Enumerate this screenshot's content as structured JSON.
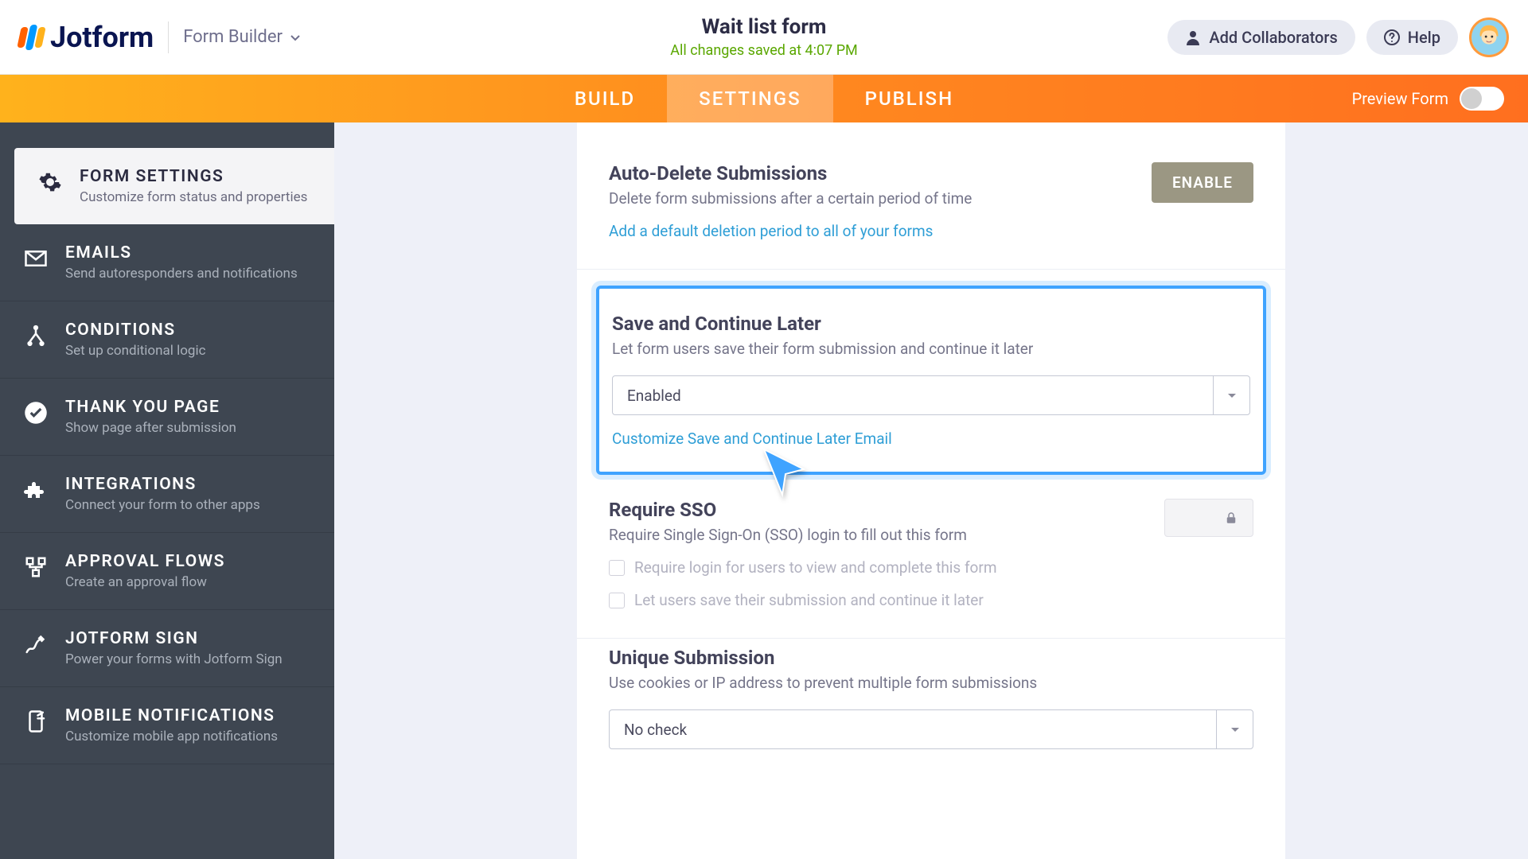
{
  "header": {
    "brand": "Jotform",
    "builder_label": "Form Builder",
    "form_title": "Wait list form",
    "save_status": "All changes saved at 4:07 PM",
    "collab_label": "Add Collaborators",
    "help_label": "Help"
  },
  "tabs": {
    "build": "BUILD",
    "settings": "SETTINGS",
    "publish": "PUBLISH",
    "preview_label": "Preview Form"
  },
  "sidebar": [
    {
      "title": "FORM SETTINGS",
      "desc": "Customize form status and properties",
      "icon": "gear-icon",
      "active": true
    },
    {
      "title": "EMAILS",
      "desc": "Send autoresponders and notifications",
      "icon": "mail-icon"
    },
    {
      "title": "CONDITIONS",
      "desc": "Set up conditional logic",
      "icon": "branch-icon"
    },
    {
      "title": "THANK YOU PAGE",
      "desc": "Show page after submission",
      "icon": "check-circle-icon"
    },
    {
      "title": "INTEGRATIONS",
      "desc": "Connect your form to other apps",
      "icon": "puzzle-icon"
    },
    {
      "title": "APPROVAL FLOWS",
      "desc": "Create an approval flow",
      "icon": "flow-icon"
    },
    {
      "title": "JOTFORM SIGN",
      "desc": "Power your forms with Jotform Sign",
      "icon": "sign-icon"
    },
    {
      "title": "MOBILE NOTIFICATIONS",
      "desc": "Customize mobile app notifications",
      "icon": "mobile-icon"
    }
  ],
  "settings": {
    "autodelete": {
      "title": "Auto-Delete Submissions",
      "desc": "Delete form submissions after a certain period of time",
      "button": "ENABLE",
      "link": "Add a default deletion period to all of your forms"
    },
    "savecontinue": {
      "title": "Save and Continue Later",
      "desc": "Let form users save their form submission and continue it later",
      "select_value": "Enabled",
      "link": "Customize Save and Continue Later Email"
    },
    "sso": {
      "title": "Require SSO",
      "desc": "Require Single Sign-On (SSO) login to fill out this form",
      "opt1": "Require login for users to view and complete this form",
      "opt2": "Let users save their submission and continue it later"
    },
    "unique": {
      "title": "Unique Submission",
      "desc": "Use cookies or IP address to prevent multiple form submissions",
      "select_value": "No check"
    }
  }
}
